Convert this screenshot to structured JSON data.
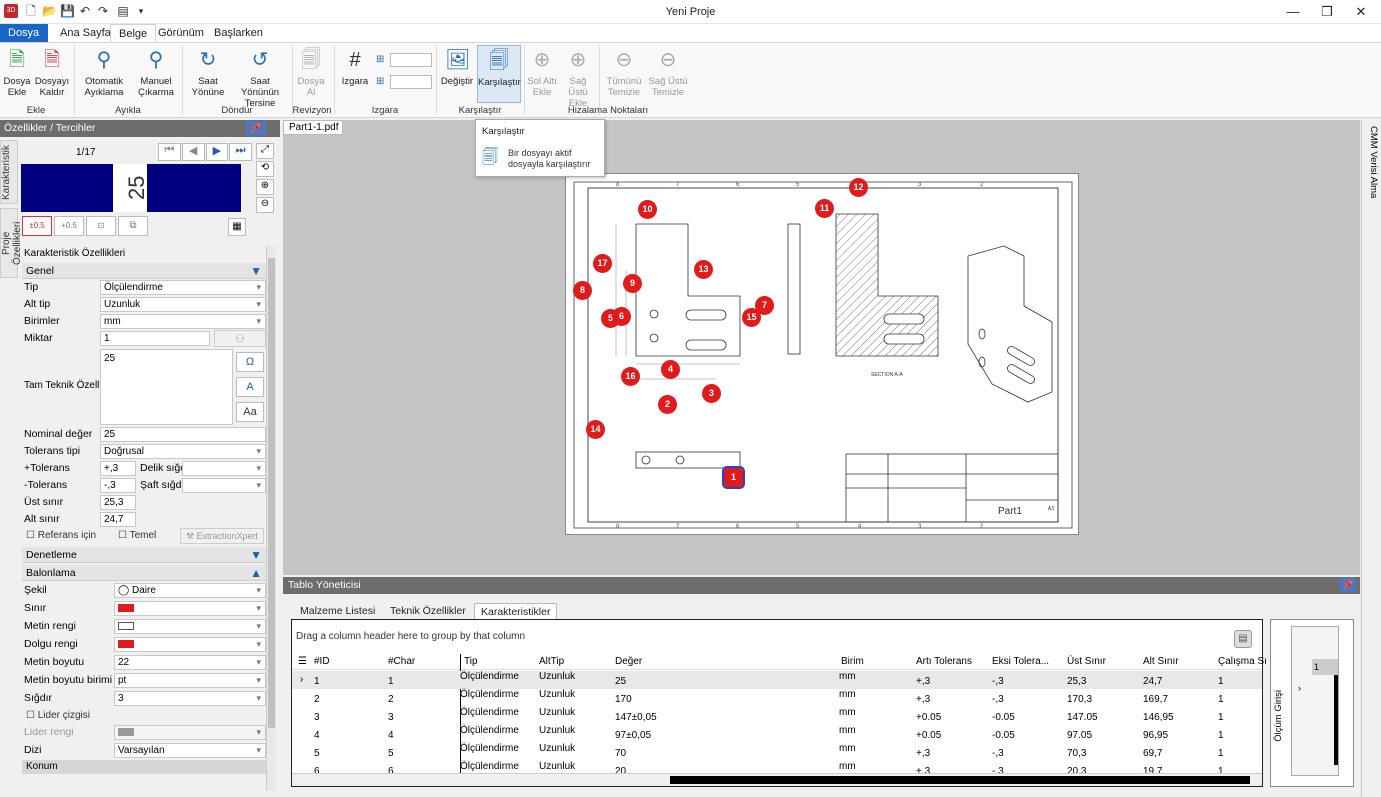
{
  "window": {
    "title": "Yeni Proje"
  },
  "tabs": [
    {
      "label": "Dosya"
    },
    {
      "label": "Ana Sayfa"
    },
    {
      "label": "Belge"
    },
    {
      "label": "Görünüm"
    },
    {
      "label": "Başlarken"
    }
  ],
  "ribbon": {
    "buttons": {
      "dosya_ekle": "Dosya Ekle",
      "dosyayi_kaldir": "Dosyayı Kaldır",
      "otomatik": "Otomatik Ayıklama",
      "manuel": "Manuel Çıkarma",
      "saat": "Saat Yönüne",
      "saat_ters": "Saat Yönünün Tersine",
      "dosya_al": "Dosya Al",
      "izgara": "Izgara",
      "degistir": "Değiştir",
      "karsilastir": "Karşılaştır",
      "sol_alti": "Sol Altı Ekle",
      "sag_ustu": "Sağ Üstü Ekle",
      "tumunu": "Tümünü Temizle",
      "sag_ustu_temizle": "Sağ Üstü Temizle"
    },
    "groups": {
      "ekle": "Ekle",
      "ayikla": "Ayıkla",
      "dondur": "Döndür",
      "revizyon": "Revizyon",
      "izgara": "Izgara",
      "karsilastir": "Karşılaştır",
      "hizalama": "Hizalama Noktaları"
    }
  },
  "tooltip": {
    "title": "Karşılaştır",
    "body": "Bir dosyayı aktif dosyayla karşılaştırır"
  },
  "left": {
    "header": "Özellikler / Tercihler",
    "vtab_karakteristik": "Karakteristik",
    "vtab_proje": "Proje Özellikleri",
    "page_counter": "1/17",
    "preview_value": "25",
    "section_title": "Karakteristik Özellikleri",
    "genel": "Genel",
    "props": [
      {
        "label": "Tip",
        "value": "Ölçülendirme"
      },
      {
        "label": "Alt tip",
        "value": "Uzunluk"
      },
      {
        "label": "Birimler",
        "value": "mm"
      },
      {
        "label": "Miktar",
        "value": "1"
      }
    ],
    "tam_label": "Tam Teknik Özelli",
    "tam_value": "25",
    "nominal_label": "Nominal değer",
    "nominal_value": "25",
    "tol_tipi_label": "Tolerans tipi",
    "tol_tipi_value": "Doğrusal",
    "plus_tol_label": "+Tolerans",
    "plus_tol_value": "+,3",
    "delik_label": "Delik sığc",
    "minus_tol_label": "-Tolerans",
    "minus_tol_value": "-,3",
    "saft_label": "Şaft sığdı",
    "ust_label": "Üst sınır",
    "ust_value": "25,3",
    "alt_label": "Alt sınır",
    "alt_value": "24,7",
    "referans": "Referans için",
    "temel": "Temel",
    "extraction": "ExtractionXpert",
    "denetleme": "Denetleme",
    "balonlama": "Balonlama",
    "bprops": [
      {
        "label": "Şekil",
        "value": "Daire"
      },
      {
        "label": "Sınır",
        "value": ""
      },
      {
        "label": "Metin rengi",
        "value": ""
      },
      {
        "label": "Dolgu rengi",
        "value": ""
      },
      {
        "label": "Metin boyutu",
        "value": "22"
      },
      {
        "label": "Metin boyutu birimi",
        "value": "pt"
      },
      {
        "label": "Sığdır",
        "value": "3"
      }
    ],
    "lider": "Lider çizgisi",
    "lider_rengi": "Lider rengi",
    "dizi_label": "Dizi",
    "dizi_value": "Varsayılan",
    "konum": "Konum"
  },
  "doc": {
    "tab": "Part1-1.pdf",
    "section_label": "SECTION A-A",
    "part_name": "Part1",
    "sheet_size": "A3",
    "balloons": [
      "10",
      "12",
      "11",
      "17",
      "13",
      "8",
      "9",
      "7",
      "5",
      "6",
      "15",
      "4",
      "16",
      "3",
      "2",
      "14",
      "1"
    ]
  },
  "table": {
    "header": "Tablo Yöneticisi",
    "tabs": [
      "Malzeme Listesi",
      "Teknik Özellikler",
      "Karakteristikler"
    ],
    "group_hint": "Drag a column header here to group by that column",
    "columns": [
      "#ID",
      "#Char",
      "Tip",
      "AltTip",
      "Değer",
      "Birim",
      "Artı Tolerans",
      "Eksi Tolera...",
      "Üst Sınır",
      "Alt Sınır",
      "Çalışma Sı"
    ],
    "rows": [
      [
        "1",
        "1",
        "Ölçülendirme",
        "Uzunluk",
        "25",
        "mm",
        "+,3",
        "-,3",
        "25,3",
        "24,7",
        "1"
      ],
      [
        "2",
        "2",
        "Ölçülendirme",
        "Uzunluk",
        "170",
        "mm",
        "+,3",
        "-,3",
        "170,3",
        "169,7",
        "1"
      ],
      [
        "3",
        "3",
        "Ölçülendirme",
        "Uzunluk",
        "147±0,05",
        "mm",
        "+0.05",
        "-0.05",
        "147.05",
        "146,95",
        "1"
      ],
      [
        "4",
        "4",
        "Ölçülendirme",
        "Uzunluk",
        "97±0,05",
        "mm",
        "+0.05",
        "-0.05",
        "97.05",
        "96,95",
        "1"
      ],
      [
        "5",
        "5",
        "Ölçülendirme",
        "Uzunluk",
        "70",
        "mm",
        "+,3",
        "-,3",
        "70,3",
        "69,7",
        "1"
      ],
      [
        "6",
        "6",
        "Ölçülendirme",
        "Uzunluk",
        "20",
        "mm",
        "+,3",
        "-,3",
        "20,3",
        "19,7",
        "1"
      ]
    ],
    "side_label": "Ölçüm Girişi",
    "side_value": "1"
  },
  "right": {
    "vtab": "CMM Verisi Alma"
  },
  "colors": {
    "accent": "#1a66c7",
    "balloon": "#e01b1b",
    "preview_bg": "#000080"
  }
}
